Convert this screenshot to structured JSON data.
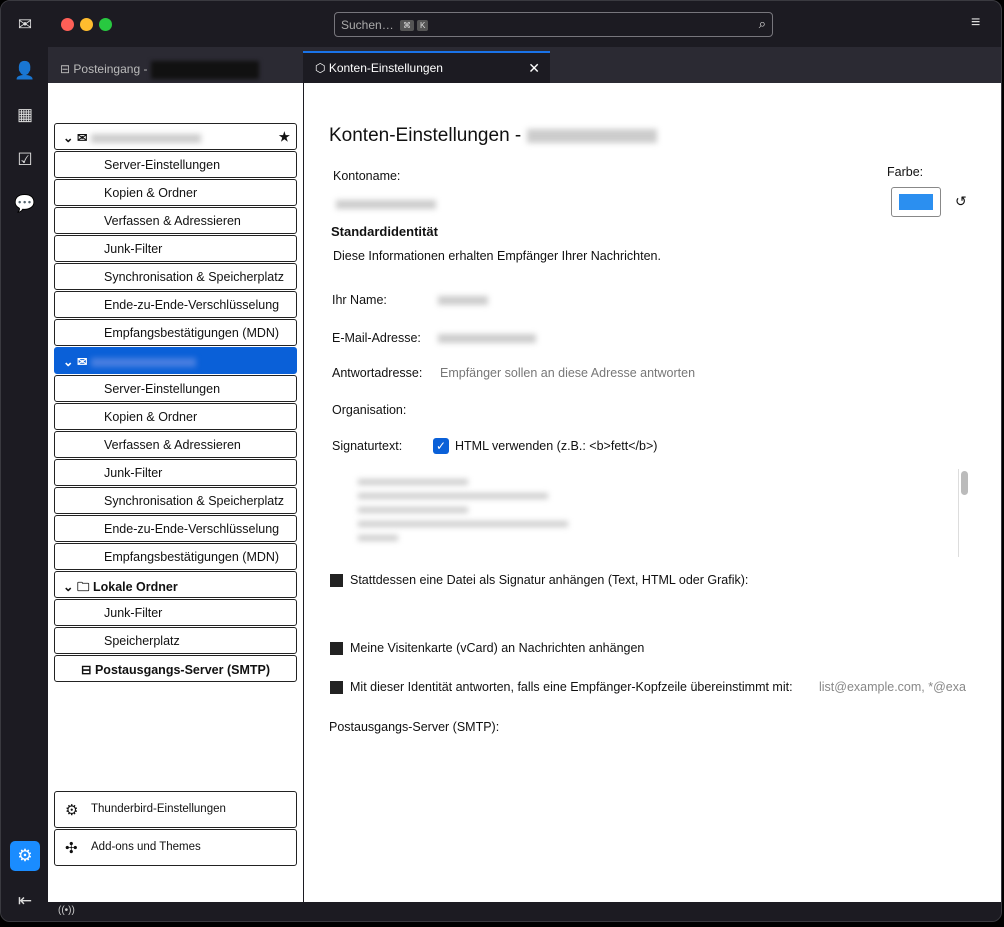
{
  "search": {
    "placeholder": "Suchen…",
    "kbd1": "⌘",
    "kbd2": "K"
  },
  "tabs": [
    {
      "label": "Posteingang -"
    },
    {
      "label": "Konten-Einstellungen",
      "close": "✕"
    }
  ],
  "accounts": [
    {
      "items": [
        "Server-Einstellungen",
        "Kopien & Ordner",
        "Verfassen & Adressieren",
        "Junk-Filter",
        "Synchronisation & Speicherplatz",
        "Ende-zu-Ende-Verschlüsselung",
        "Empfangsbestätigungen (MDN)"
      ]
    },
    {
      "items": [
        "Server-Einstellungen",
        "Kopien & Ordner",
        "Verfassen & Adressieren",
        "Junk-Filter",
        "Synchronisation & Speicherplatz",
        "Ende-zu-Ende-Verschlüsselung",
        "Empfangsbestätigungen (MDN)"
      ]
    }
  ],
  "local": {
    "label": "Lokale Ordner",
    "items": [
      "Junk-Filter",
      "Speicherplatz"
    ]
  },
  "smtp": "Postausgangs-Server (SMTP)",
  "bottom": {
    "settings": "Thunderbird-Einstellungen",
    "addons": "Add-ons und Themes"
  },
  "main": {
    "title": "Konten-Einstellungen -",
    "account_name_label": "Kontoname:",
    "color_label": "Farbe:",
    "color": "#2b8ff0",
    "identity_heading": "Standardidentität",
    "identity_desc": "Diese Informationen erhalten Empfänger Ihrer Nachrichten.",
    "name_label": "Ihr Name:",
    "email_label": "E-Mail-Adresse:",
    "reply_label": "Antwortadresse:",
    "reply_placeholder": "Empfänger sollen an diese Adresse antworten",
    "org_label": "Organisation:",
    "sig_label": "Signaturtext:",
    "html_label": "HTML verwenden (z.B.: <b>fett</b>)",
    "file_sig_label": "Stattdessen eine Datei als Signatur anhängen (Text, HTML oder Grafik):",
    "vcard_label": "Meine Visitenkarte (vCard) an Nachrichten anhängen",
    "reply_match_label": "Mit dieser Identität antworten, falls eine Empfänger-Kopfzeile übereinstimmt mit:",
    "reply_match_placeholder": "list@example.com, *@exa",
    "smtp_label": "Postausgangs-Server (SMTP):"
  }
}
